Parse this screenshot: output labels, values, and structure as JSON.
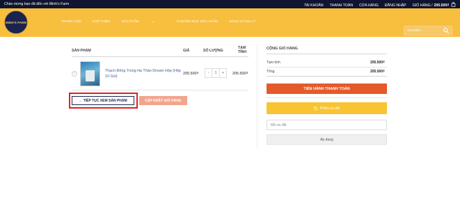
{
  "topbar": {
    "welcome": "Chào mừng bạn đã đến với Minh's Farm",
    "links": [
      "TÀI KHOẢN",
      "THANH TOÁN",
      "CỬA HÀNG",
      "ĐĂNG NHẬP"
    ],
    "cart_label": "GIỎ HÀNG /",
    "cart_total": "205.500₫"
  },
  "header": {
    "logo_text": "MINH'S FARM",
    "nav": [
      "TRANG CHỦ",
      "GIỚI THIỆU",
      "SẢN PHẨM",
      "CHUYÊN MỤC SỨC KHỎE",
      "ĐĂNG KÝ ĐẠI LÝ"
    ],
    "search_placeholder": "Tìm kiếm..."
  },
  "cart": {
    "headers": {
      "product": "SẢN PHẨM",
      "price": "GIÁ",
      "quantity": "SỐ LƯỢNG",
      "subtotal_line1": "TẠM",
      "subtotal_line2": "TÍNH"
    },
    "items": [
      {
        "name": "Thạch Đông Trùng Hạ Thảo Dream Hộp (Hộp 10 Gói)",
        "price": "205.500₫",
        "quantity": "1",
        "subtotal": "205.500₫"
      }
    ],
    "continue_label": "← TIẾP TỤC XEM SẢN PHẨM",
    "update_label": "CẬP NHẬT GIỎ HÀNG"
  },
  "totals": {
    "title": "CỘNG GIỎ HÀNG",
    "subtotal_label": "Tạm tính",
    "subtotal_value": "205.500₫",
    "total_label": "Tổng",
    "total_value": "205.500₫",
    "checkout_label": "TIẾN HÀNH THANH TOÁN",
    "coupon_button": "Phiếu ưu đãi",
    "coupon_placeholder": "Mã ưu đãi",
    "apply_label": "Áp dụng"
  },
  "colors": {
    "topbar": "#0f1430",
    "header": "#f8be3e",
    "checkout": "#e45a2a",
    "coupon": "#f8c431",
    "highlight": "#e21d1d"
  }
}
